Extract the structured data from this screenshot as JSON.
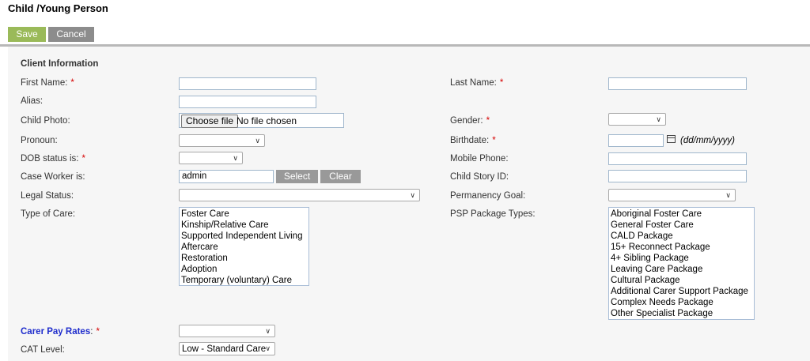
{
  "page": {
    "title": "Child /Young Person"
  },
  "toolbar": {
    "save_label": "Save",
    "cancel_label": "Cancel"
  },
  "section": {
    "title": "Client Information"
  },
  "labels": {
    "first_name": "First Name:",
    "last_name": "Last Name:",
    "alias": "Alias:",
    "child_photo": "Child Photo:",
    "gender": "Gender:",
    "pronoun": "Pronoun:",
    "birthdate": "Birthdate:",
    "dob_status": "DOB status is:",
    "mobile_phone": "Mobile Phone:",
    "case_worker": "Case Worker is:",
    "child_story_id": "Child Story ID:",
    "legal_status": "Legal Status:",
    "permanency_goal": "Permanency Goal:",
    "type_of_care": "Type of Care:",
    "psp_package_types": "PSP Package Types:",
    "carer_pay_rates": "Carer Pay Rates",
    "cat_level": "CAT Level:",
    "required_mark": "*",
    "colon": ":"
  },
  "fields": {
    "file_button": "Choose file",
    "file_status": "No file chosen",
    "case_worker_value": "admin",
    "case_worker_select": "Select",
    "case_worker_clear": "Clear",
    "birthdate_hint": "(dd/mm/yyyy)",
    "cat_level_selected": "Low - Standard Care"
  },
  "type_of_care_options": [
    "Foster Care",
    "Kinship/Relative Care",
    "Supported Independent Living",
    "Aftercare",
    "Restoration",
    "Adoption",
    "Temporary (voluntary) Care"
  ],
  "psp_package_options": [
    "Aboriginal Foster Care",
    "General Foster Care",
    "CALD Package",
    "15+ Reconnect Package",
    "4+ Sibling Package",
    "Leaving Care Package",
    "Cultural Package",
    "Additional Carer Support Package",
    "Complex Needs Package",
    "Other Specialist Package"
  ],
  "icons": {
    "dropdown": "chevron-down-icon",
    "calendar": "calendar-icon"
  },
  "colors": {
    "save": "#9aba59",
    "cancel": "#8c8c8c",
    "required": "#d60000",
    "link_label": "#1f2dcc"
  }
}
